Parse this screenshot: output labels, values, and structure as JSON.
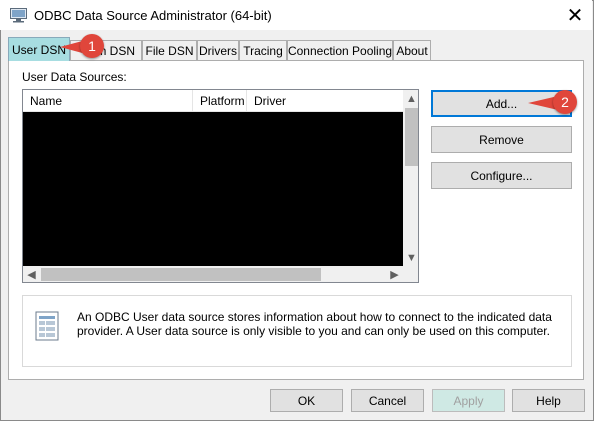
{
  "window": {
    "title": "ODBC Data Source Administrator (64-bit)"
  },
  "tabs": [
    {
      "label": "User DSN",
      "active": true
    },
    {
      "label": "System DSN",
      "visible_text": "m DSN"
    },
    {
      "label": "File DSN"
    },
    {
      "label": "Drivers"
    },
    {
      "label": "Tracing"
    },
    {
      "label": "Connection Pooling"
    },
    {
      "label": "About"
    }
  ],
  "user_dsn": {
    "group_label": "User Data Sources:",
    "columns": [
      "Name",
      "Platform",
      "Driver"
    ],
    "rows_redacted": true,
    "buttons": {
      "add": "Add...",
      "remove": "Remove",
      "configure": "Configure..."
    },
    "info_text": "An ODBC User data source stores information about how to connect to the indicated data provider.   A User data source is only visible to you and can only be used on this computer."
  },
  "footer_buttons": {
    "ok": "OK",
    "cancel": "Cancel",
    "apply": "Apply",
    "help": "Help"
  },
  "callouts": [
    {
      "number": "1"
    },
    {
      "number": "2"
    }
  ],
  "colors": {
    "callout": "#e0463b",
    "active_tab": "#a7dde1",
    "apply_bg": "#cfe9e4",
    "focus_border": "#0078d7"
  }
}
